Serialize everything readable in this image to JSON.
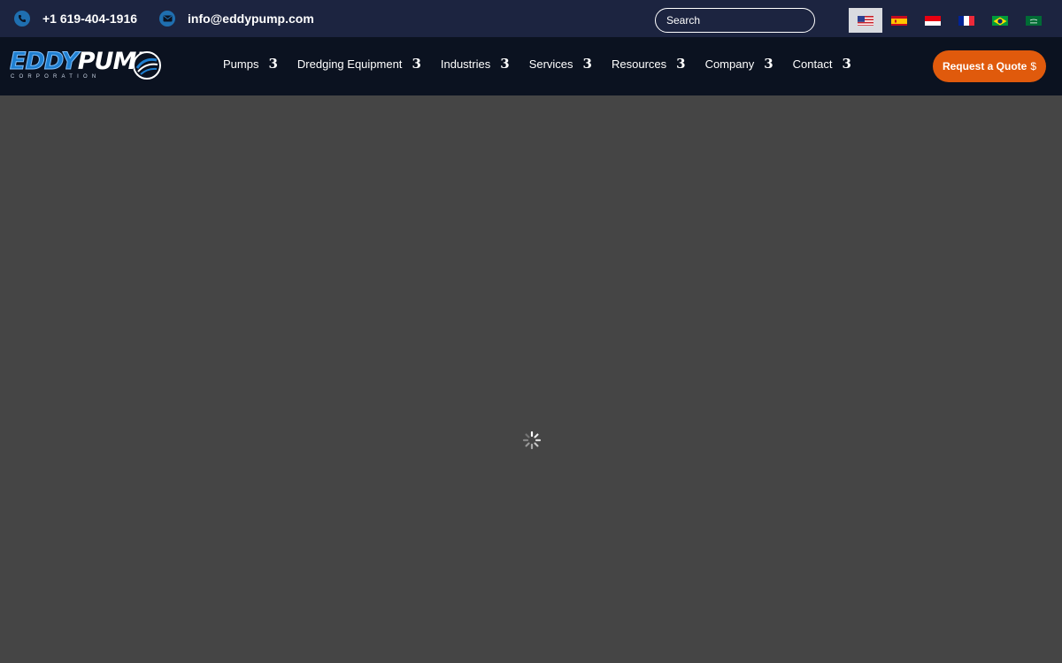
{
  "topbar": {
    "phone": "+1 619-404-1916",
    "email": "info@eddypump.com",
    "search_placeholder": "Search",
    "flags": [
      {
        "name": "flag-us",
        "active": true
      },
      {
        "name": "flag-es",
        "active": false
      },
      {
        "name": "flag-id",
        "active": false
      },
      {
        "name": "flag-fr",
        "active": false
      },
      {
        "name": "flag-br",
        "active": false
      },
      {
        "name": "flag-sa",
        "active": false
      }
    ]
  },
  "logo": {
    "word_part1": "EDDY",
    "word_part2": "PUMP",
    "subtitle": "CORPORATION"
  },
  "nav": {
    "items": [
      {
        "label": "Pumps",
        "chevron": "3"
      },
      {
        "label": "Dredging Equipment",
        "chevron": "3"
      },
      {
        "label": "Industries",
        "chevron": "3"
      },
      {
        "label": "Services",
        "chevron": "3"
      },
      {
        "label": "Resources",
        "chevron": "3"
      },
      {
        "label": "Company",
        "chevron": "3"
      },
      {
        "label": "Contact",
        "chevron": "3"
      }
    ],
    "quote_button": "Request a Quote",
    "quote_icon": "$"
  },
  "colors": {
    "topbar_bg": "#1c2440",
    "navbar_bg": "#0b1220",
    "content_bg": "#454545",
    "accent_orange": "#e05a0c",
    "icon_blue": "#1f6fb0"
  },
  "icons": {
    "phone": "phone-icon",
    "email": "email-icon",
    "spinner": "loading-spinner-icon"
  }
}
